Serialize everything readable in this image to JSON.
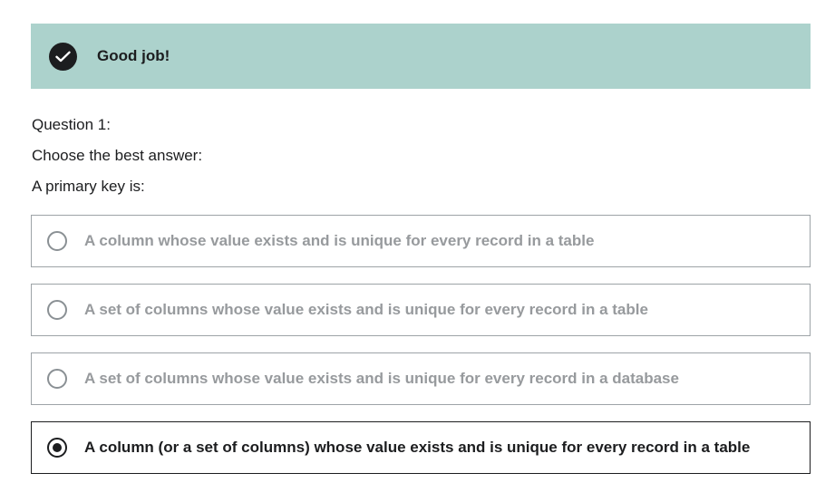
{
  "feedback": {
    "icon": "check-circle-icon",
    "message": "Good job!",
    "background": "#acd2cc"
  },
  "question": {
    "number_label": "Question 1:",
    "instruction": "Choose the best answer:",
    "prompt": "A primary key is:"
  },
  "options": [
    {
      "label": "A column whose value exists and is unique for every record in a table",
      "selected": false
    },
    {
      "label": "A set of columns whose value exists and is unique for every record in a table",
      "selected": false
    },
    {
      "label": "A set of columns whose value exists and is unique for every record in a database",
      "selected": false
    },
    {
      "label": "A column (or a set of columns) whose value exists and is unique for every record in a table",
      "selected": true
    }
  ]
}
